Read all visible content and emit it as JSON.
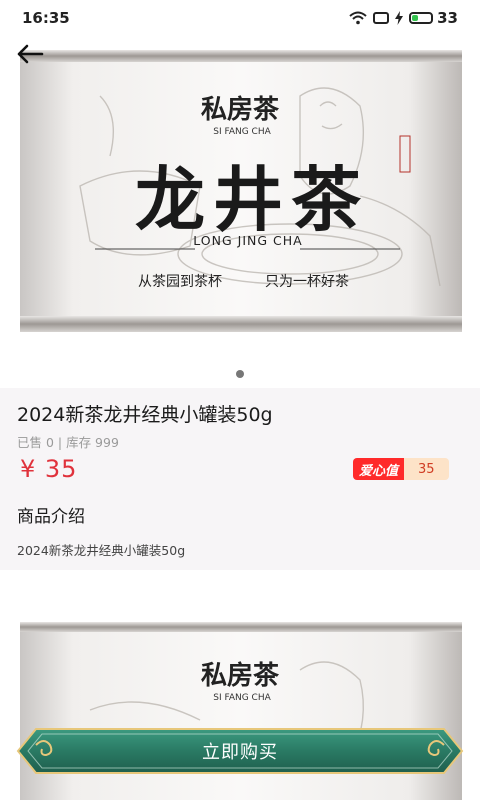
{
  "status": {
    "time": "16:35",
    "battery": "33",
    "battery_level": 0.33
  },
  "product": {
    "image_brand": "私房茶",
    "image_brand_pinyin": "SI FANG CHA",
    "image_name": "龙井茶",
    "image_name_pinyin": "LONG JING CHA",
    "image_slogan_left": "从茶园到茶杯",
    "image_slogan_right": "只为一杯好茶",
    "title": "2024新茶龙井经典小罐装50g",
    "meta": "已售 0 | 库存 999",
    "price": "¥ 35",
    "love_label": "爱心值",
    "love_value": "35",
    "section_title": "商品介绍",
    "description": "2024新茶龙井经典小罐装50g"
  },
  "actions": {
    "buy": "立即购买"
  },
  "colors": {
    "price": "#e0323c",
    "buy_button": "#2d7f6a",
    "love_badge": "#ff2a2a"
  }
}
